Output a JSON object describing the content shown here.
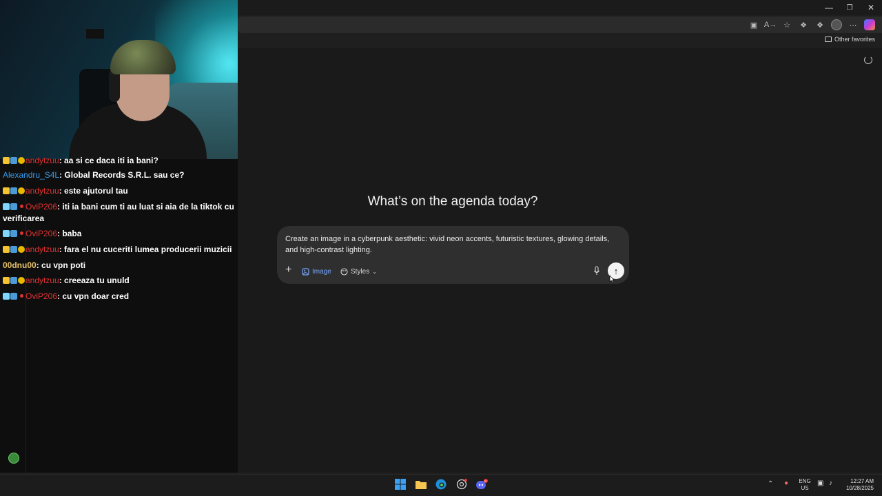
{
  "browser": {
    "favorites_label": "Other favorites",
    "window_controls": [
      "minimize-icon",
      "restore-icon",
      "close-icon"
    ],
    "address_icons": [
      "camera-off-icon",
      "read-aloud-icon",
      "star-icon",
      "extensions-icon",
      "collections-icon",
      "profile-avatar",
      "more-icon",
      "copilot-icon"
    ]
  },
  "chat": {
    "messages": [
      {
        "badges": [
          "crown",
          "sub",
          "num"
        ],
        "user": "andytzuu",
        "user_color": "red",
        "text": "aa si ce daca iti ia bani?"
      },
      {
        "badges": [],
        "user": "Alexandru_S4L",
        "user_color": "blue",
        "text": "Global Records S.R.L. sau ce?"
      },
      {
        "badges": [
          "crown",
          "sub",
          "num"
        ],
        "user": "andytzuu",
        "user_color": "red",
        "text": "este ajutorul tau"
      },
      {
        "badges": [
          "sword",
          "sub",
          "heart"
        ],
        "user": "OviP206",
        "user_color": "red",
        "text": "iti ia bani cum ti au luat si aia de la tiktok cu verificarea"
      },
      {
        "badges": [
          "sword",
          "sub",
          "heart"
        ],
        "user": "OviP206",
        "user_color": "red",
        "text": "baba"
      },
      {
        "badges": [
          "crown",
          "sub",
          "num"
        ],
        "user": "andytzuu",
        "user_color": "red",
        "text": "fara el nu cuceriti lumea producerii muzicii"
      },
      {
        "badges": [],
        "user": "00dnu00",
        "user_color": "yellow",
        "text": "cu vpn poti"
      },
      {
        "badges": [
          "crown",
          "sub",
          "num"
        ],
        "user": "andytzuu",
        "user_color": "red",
        "text": "creeaza tu unuld"
      },
      {
        "badges": [
          "sword",
          "sub",
          "heart"
        ],
        "user": "OviP206",
        "user_color": "red",
        "text": "cu vpn doar cred"
      }
    ]
  },
  "copilot": {
    "headline": "What’s on the agenda today?",
    "prompt": "Create an image in a cyberpunk aesthetic: vivid neon accents, futuristic textures, glowing details, and high-contrast lighting.",
    "image_chip": "Image",
    "styles_label": "Styles",
    "accent_color": "#79a7ff"
  },
  "taskbar": {
    "lang_line1": "ENG",
    "lang_line2": "US",
    "time": "12:27 AM",
    "date": "10/28/2025",
    "apps": [
      "windows-start-icon",
      "file-explorer-icon",
      "edge-icon",
      "chatgpt-icon",
      "discord-icon"
    ],
    "discord_badge": "9+"
  }
}
